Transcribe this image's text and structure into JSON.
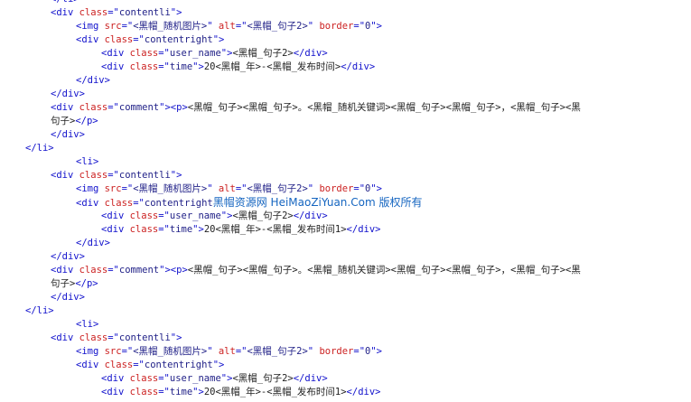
{
  "code_lines": [
    {
      "indent": 4,
      "tokens": [
        {
          "t": "<",
          "c": "punc"
        },
        {
          "t": "/li",
          "c": "tag"
        },
        {
          "t": ">",
          "c": "punc"
        }
      ]
    },
    {
      "indent": 4,
      "tokens": [
        {
          "t": "<div ",
          "c": "tag"
        },
        {
          "t": "class",
          "c": "attr"
        },
        {
          "t": "=\"",
          "c": "punc"
        },
        {
          "t": "contentli",
          "c": "str"
        },
        {
          "t": "\">",
          "c": "punc"
        }
      ]
    },
    {
      "indent": 8,
      "tokens": [
        {
          "t": "<img ",
          "c": "tag"
        },
        {
          "t": "src",
          "c": "attr"
        },
        {
          "t": "=\"",
          "c": "punc"
        },
        {
          "t": "<黑帽_随机图片>",
          "c": "str"
        },
        {
          "t": "\" ",
          "c": "punc"
        },
        {
          "t": "alt",
          "c": "attr"
        },
        {
          "t": "=\"",
          "c": "punc"
        },
        {
          "t": "<黑帽_句子2>",
          "c": "str"
        },
        {
          "t": "\" ",
          "c": "punc"
        },
        {
          "t": "border",
          "c": "attr"
        },
        {
          "t": "=\"",
          "c": "punc"
        },
        {
          "t": "0",
          "c": "str"
        },
        {
          "t": "\">",
          "c": "punc"
        }
      ]
    },
    {
      "indent": 8,
      "tokens": [
        {
          "t": "<div ",
          "c": "tag"
        },
        {
          "t": "class",
          "c": "attr"
        },
        {
          "t": "=\"",
          "c": "punc"
        },
        {
          "t": "contentright",
          "c": "str"
        },
        {
          "t": "\">",
          "c": "punc"
        }
      ]
    },
    {
      "indent": 12,
      "tokens": [
        {
          "t": "<div ",
          "c": "tag"
        },
        {
          "t": "class",
          "c": "attr"
        },
        {
          "t": "=\"",
          "c": "punc"
        },
        {
          "t": "user_name",
          "c": "str"
        },
        {
          "t": "\">",
          "c": "punc"
        },
        {
          "t": "<黑帽_句子2>",
          "c": "text"
        },
        {
          "t": "</div>",
          "c": "tag"
        }
      ]
    },
    {
      "indent": 12,
      "tokens": [
        {
          "t": "<div ",
          "c": "tag"
        },
        {
          "t": "class",
          "c": "attr"
        },
        {
          "t": "=\"",
          "c": "punc"
        },
        {
          "t": "time",
          "c": "str"
        },
        {
          "t": "\">",
          "c": "punc"
        },
        {
          "t": "20<黑帽_年>-<黑帽_发布时间>",
          "c": "text"
        },
        {
          "t": "</div>",
          "c": "tag"
        }
      ]
    },
    {
      "indent": 8,
      "tokens": [
        {
          "t": "</div>",
          "c": "tag"
        }
      ]
    },
    {
      "indent": 4,
      "tokens": [
        {
          "t": "</div>",
          "c": "tag"
        }
      ]
    },
    {
      "indent": 4,
      "tokens": [
        {
          "t": "<div ",
          "c": "tag"
        },
        {
          "t": "class",
          "c": "attr"
        },
        {
          "t": "=\"",
          "c": "punc"
        },
        {
          "t": "comment",
          "c": "str"
        },
        {
          "t": "\">",
          "c": "punc"
        },
        {
          "t": "<p>",
          "c": "tag"
        },
        {
          "t": "<黑帽_句子><黑帽_句子>。<黑帽_随机关键词><黑帽_句子><黑帽_句子>，<黑帽_句子><黑",
          "c": "text"
        }
      ]
    },
    {
      "indent": 4,
      "tokens": [
        {
          "t": "句子>",
          "c": "text"
        },
        {
          "t": "</p>",
          "c": "tag"
        }
      ]
    },
    {
      "indent": 4,
      "tokens": [
        {
          "t": "</div>",
          "c": "tag"
        }
      ]
    },
    {
      "indent": 0,
      "tokens": [
        {
          "t": "</li>",
          "c": "tag"
        }
      ]
    },
    {
      "indent": 8,
      "tokens": [
        {
          "t": "<li>",
          "c": "tag"
        }
      ]
    },
    {
      "indent": 4,
      "tokens": [
        {
          "t": "<div ",
          "c": "tag"
        },
        {
          "t": "class",
          "c": "attr"
        },
        {
          "t": "=\"",
          "c": "punc"
        },
        {
          "t": "contentli",
          "c": "str"
        },
        {
          "t": "\">",
          "c": "punc"
        }
      ]
    },
    {
      "indent": 8,
      "tokens": [
        {
          "t": "<img ",
          "c": "tag"
        },
        {
          "t": "src",
          "c": "attr"
        },
        {
          "t": "=\"",
          "c": "punc"
        },
        {
          "t": "<黑帽_随机图片>",
          "c": "str"
        },
        {
          "t": "\" ",
          "c": "punc"
        },
        {
          "t": "alt",
          "c": "attr"
        },
        {
          "t": "=\"",
          "c": "punc"
        },
        {
          "t": "<黑帽_句子2>",
          "c": "str"
        },
        {
          "t": "\" ",
          "c": "punc"
        },
        {
          "t": "border",
          "c": "attr"
        },
        {
          "t": "=\"",
          "c": "punc"
        },
        {
          "t": "0",
          "c": "str"
        },
        {
          "t": "\">",
          "c": "punc"
        }
      ]
    },
    {
      "indent": 8,
      "tokens": [
        {
          "t": "<div ",
          "c": "tag"
        },
        {
          "t": "class",
          "c": "attr"
        },
        {
          "t": "=\"",
          "c": "punc"
        },
        {
          "t": "contentright",
          "c": "str"
        },
        {
          "t": "黑帽资源网 HeiMaoZiYuan.Com 版权所有",
          "c": "wm"
        }
      ]
    },
    {
      "indent": 12,
      "tokens": [
        {
          "t": "<div ",
          "c": "tag"
        },
        {
          "t": "class",
          "c": "attr"
        },
        {
          "t": "=\"",
          "c": "punc"
        },
        {
          "t": "user_name",
          "c": "str"
        },
        {
          "t": "\">",
          "c": "punc"
        },
        {
          "t": "<黑帽_句子2>",
          "c": "text"
        },
        {
          "t": "</div>",
          "c": "tag"
        }
      ]
    },
    {
      "indent": 12,
      "tokens": [
        {
          "t": "<div ",
          "c": "tag"
        },
        {
          "t": "class",
          "c": "attr"
        },
        {
          "t": "=\"",
          "c": "punc"
        },
        {
          "t": "time",
          "c": "str"
        },
        {
          "t": "\">",
          "c": "punc"
        },
        {
          "t": "20<黑帽_年>-<黑帽_发布时间1>",
          "c": "text"
        },
        {
          "t": "</div>",
          "c": "tag"
        }
      ]
    },
    {
      "indent": 8,
      "tokens": [
        {
          "t": "</div>",
          "c": "tag"
        }
      ]
    },
    {
      "indent": 4,
      "tokens": [
        {
          "t": "</div>",
          "c": "tag"
        }
      ]
    },
    {
      "indent": 4,
      "tokens": [
        {
          "t": "<div ",
          "c": "tag"
        },
        {
          "t": "class",
          "c": "attr"
        },
        {
          "t": "=\"",
          "c": "punc"
        },
        {
          "t": "comment",
          "c": "str"
        },
        {
          "t": "\">",
          "c": "punc"
        },
        {
          "t": "<p>",
          "c": "tag"
        },
        {
          "t": "<黑帽_句子><黑帽_句子>。<黑帽_随机关键词><黑帽_句子><黑帽_句子>，<黑帽_句子><黑",
          "c": "text"
        }
      ]
    },
    {
      "indent": 4,
      "tokens": [
        {
          "t": "句子>",
          "c": "text"
        },
        {
          "t": "</p>",
          "c": "tag"
        }
      ]
    },
    {
      "indent": 4,
      "tokens": [
        {
          "t": "</div>",
          "c": "tag"
        }
      ]
    },
    {
      "indent": 0,
      "tokens": [
        {
          "t": "</li>",
          "c": "tag"
        }
      ]
    },
    {
      "indent": 8,
      "tokens": [
        {
          "t": "<li>",
          "c": "tag"
        }
      ]
    },
    {
      "indent": 4,
      "tokens": [
        {
          "t": "<div ",
          "c": "tag"
        },
        {
          "t": "class",
          "c": "attr"
        },
        {
          "t": "=\"",
          "c": "punc"
        },
        {
          "t": "contentli",
          "c": "str"
        },
        {
          "t": "\">",
          "c": "punc"
        }
      ]
    },
    {
      "indent": 8,
      "tokens": [
        {
          "t": "<img ",
          "c": "tag"
        },
        {
          "t": "src",
          "c": "attr"
        },
        {
          "t": "=\"",
          "c": "punc"
        },
        {
          "t": "<黑帽_随机图片>",
          "c": "str"
        },
        {
          "t": "\" ",
          "c": "punc"
        },
        {
          "t": "alt",
          "c": "attr"
        },
        {
          "t": "=\"",
          "c": "punc"
        },
        {
          "t": "<黑帽_句子2>",
          "c": "str"
        },
        {
          "t": "\" ",
          "c": "punc"
        },
        {
          "t": "border",
          "c": "attr"
        },
        {
          "t": "=\"",
          "c": "punc"
        },
        {
          "t": "0",
          "c": "str"
        },
        {
          "t": "\">",
          "c": "punc"
        }
      ]
    },
    {
      "indent": 8,
      "tokens": [
        {
          "t": "<div ",
          "c": "tag"
        },
        {
          "t": "class",
          "c": "attr"
        },
        {
          "t": "=\"",
          "c": "punc"
        },
        {
          "t": "contentright",
          "c": "str"
        },
        {
          "t": "\">",
          "c": "punc"
        }
      ]
    },
    {
      "indent": 12,
      "tokens": [
        {
          "t": "<div ",
          "c": "tag"
        },
        {
          "t": "class",
          "c": "attr"
        },
        {
          "t": "=\"",
          "c": "punc"
        },
        {
          "t": "user_name",
          "c": "str"
        },
        {
          "t": "\">",
          "c": "punc"
        },
        {
          "t": "<黑帽_句子2>",
          "c": "text"
        },
        {
          "t": "</div>",
          "c": "tag"
        }
      ]
    },
    {
      "indent": 12,
      "tokens": [
        {
          "t": "<div ",
          "c": "tag"
        },
        {
          "t": "class",
          "c": "attr"
        },
        {
          "t": "=\"",
          "c": "punc"
        },
        {
          "t": "time",
          "c": "str"
        },
        {
          "t": "\">",
          "c": "punc"
        },
        {
          "t": "20<黑帽_年>-<黑帽_发布时间1>",
          "c": "text"
        },
        {
          "t": "</div>",
          "c": "tag"
        }
      ]
    }
  ]
}
